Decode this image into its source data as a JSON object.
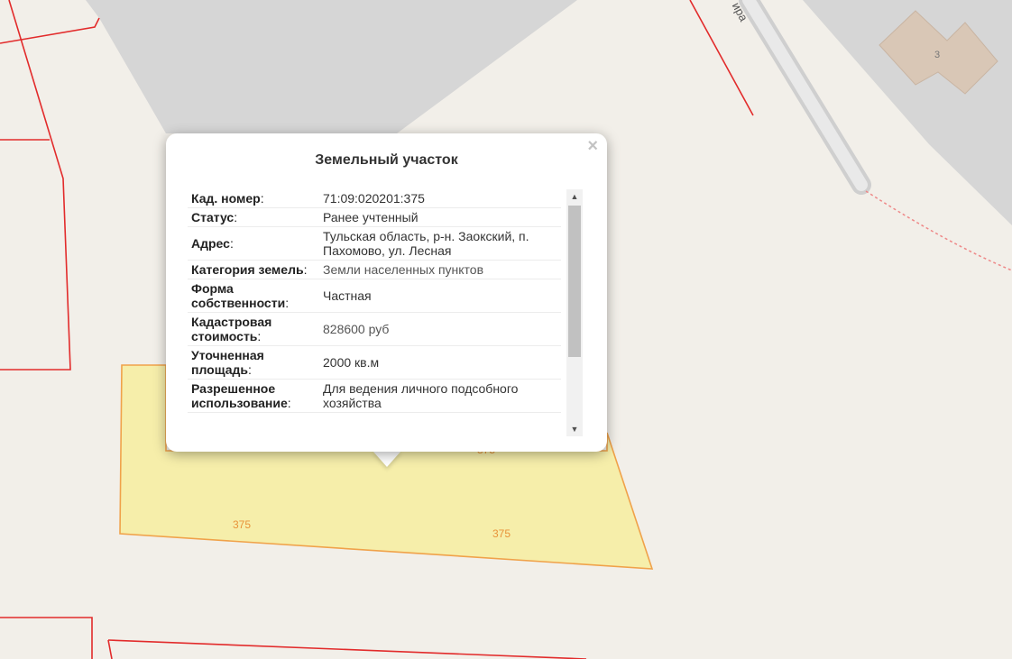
{
  "map": {
    "parcel_labels": [
      "375",
      "375",
      "375"
    ],
    "building_label": "3",
    "street_label_fragment": "ира",
    "colors": {
      "background": "#f2efe9",
      "boundary": "#e22b2b",
      "parcel_fill": "#f6eeaa",
      "parcel_stroke": "#f0a24a",
      "gray_area": "#d6d6d6",
      "building": "#d9c7b6"
    }
  },
  "popup": {
    "title": "Земельный участок",
    "close_icon": "close-icon",
    "rows": [
      {
        "key": "Кад. номер",
        "value": "71:09:020201:375"
      },
      {
        "key": "Статус",
        "value": "Ранее учтенный"
      },
      {
        "key": "Адрес",
        "value": "Тульская область, р-н. Заокский, п. Пахомово, ул. Лесная"
      },
      {
        "key": "Категория земель",
        "value": "Земли населенных пунктов"
      },
      {
        "key": "Форма собственности",
        "value": "Частная"
      },
      {
        "key": "Кадастровая стоимость",
        "value": "828600 руб"
      },
      {
        "key": "Уточненная площадь",
        "value": "2000 кв.м"
      },
      {
        "key": "Разрешенное использование",
        "value": "Для ведения личного подсобного хозяйства"
      }
    ]
  }
}
